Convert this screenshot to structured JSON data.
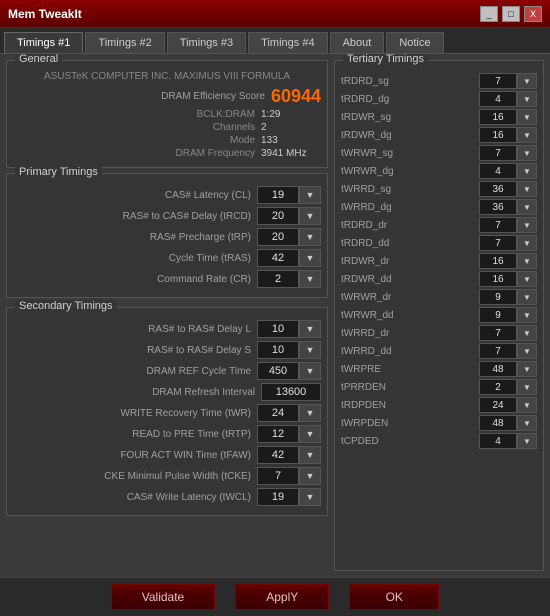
{
  "titleBar": {
    "title": "Mem TweakIt",
    "minimizeLabel": "_",
    "maximizeLabel": "□",
    "closeLabel": "X"
  },
  "tabs": [
    {
      "label": "Timings #1",
      "active": true
    },
    {
      "label": "Timings #2",
      "active": false
    },
    {
      "label": "Timings #3",
      "active": false
    },
    {
      "label": "Timings #4",
      "active": false
    },
    {
      "label": "About",
      "active": false
    },
    {
      "label": "Notice",
      "active": false
    }
  ],
  "general": {
    "title": "General",
    "moboName": "ASUSTeK COMPUTER INC. MAXIMUS VIII FORMULA",
    "dramScoreLabel": "DRAM Efficiency Score",
    "dramScoreValue": "60944",
    "bclkLabel": "BCLK:DRAM",
    "bclkValue": "1:29",
    "channelsLabel": "Channels",
    "channelsValue": "2",
    "modeLabel": "Mode",
    "modeValue": "133",
    "freqLabel": "DRAM Frequency",
    "freqValue": "3941 MHz"
  },
  "primaryTimings": {
    "title": "Primary Timings",
    "rows": [
      {
        "label": "CAS# Latency (CL)",
        "value": "19"
      },
      {
        "label": "RAS# to CAS# Delay (tRCD)",
        "value": "20"
      },
      {
        "label": "RAS# Precharge (tRP)",
        "value": "20"
      },
      {
        "label": "Cycle Time (tRAS)",
        "value": "42"
      },
      {
        "label": "Command Rate (CR)",
        "value": "2"
      }
    ]
  },
  "secondaryTimings": {
    "title": "Secondary Timings",
    "rows": [
      {
        "label": "RAS# to RAS# Delay L",
        "value": "10",
        "wide": false
      },
      {
        "label": "RAS# to RAS# Delay S",
        "value": "10",
        "wide": false
      },
      {
        "label": "DRAM REF Cycle Time",
        "value": "450",
        "wide": false
      },
      {
        "label": "DRAM Refresh Interval",
        "value": "13600",
        "wide": true
      },
      {
        "label": "WRITE Recovery Time (tWR)",
        "value": "24",
        "wide": false
      },
      {
        "label": "READ to PRE Time (tRTP)",
        "value": "12",
        "wide": false
      },
      {
        "label": "FOUR ACT WIN Time (tFAW)",
        "value": "42",
        "wide": false
      },
      {
        "label": "CKE Minimul Pulse Width (tCKE)",
        "value": "7",
        "wide": false
      },
      {
        "label": "CAS# Write Latency (tWCL)",
        "value": "19",
        "wide": false
      }
    ]
  },
  "tertiaryTimings": {
    "title": "Tertiary Timings",
    "rows": [
      {
        "label": "tRDRD_sg",
        "value": "7"
      },
      {
        "label": "tRDRD_dg",
        "value": "4"
      },
      {
        "label": "tRDWR_sg",
        "value": "16"
      },
      {
        "label": "tRDWR_dg",
        "value": "16"
      },
      {
        "label": "tWRWR_sg",
        "value": "7"
      },
      {
        "label": "tWRWR_dg",
        "value": "4"
      },
      {
        "label": "tWRRD_sg",
        "value": "36"
      },
      {
        "label": "tWRRD_dg",
        "value": "36"
      },
      {
        "label": "tRDRD_dr",
        "value": "7"
      },
      {
        "label": "tRDRD_dd",
        "value": "7"
      },
      {
        "label": "tRDWR_dr",
        "value": "16"
      },
      {
        "label": "tRDWR_dd",
        "value": "16"
      },
      {
        "label": "tWRWR_dr",
        "value": "9"
      },
      {
        "label": "tWRWR_dd",
        "value": "9"
      },
      {
        "label": "tWRRD_dr",
        "value": "7"
      },
      {
        "label": "tWRRD_dd",
        "value": "7"
      },
      {
        "label": "tWRPRE",
        "value": "48"
      },
      {
        "label": "tPRRDEN",
        "value": "2"
      },
      {
        "label": "tRDPDEN",
        "value": "24"
      },
      {
        "label": "tWRPDEN",
        "value": "48"
      },
      {
        "label": "tCPDED",
        "value": "4"
      }
    ]
  },
  "buttons": {
    "validate": "Validate",
    "apply": "ApplY",
    "ok": "OK"
  }
}
